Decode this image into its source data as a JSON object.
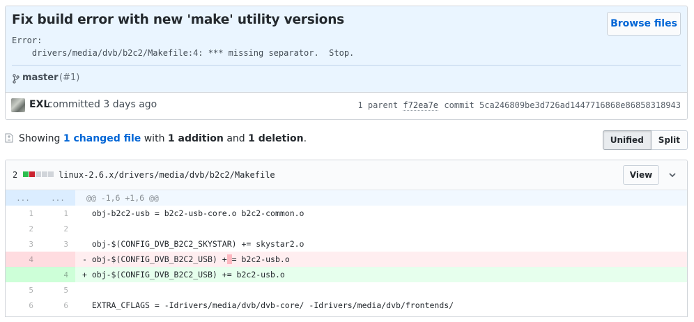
{
  "commit": {
    "title": "Fix build error with new 'make' utility versions",
    "description": "Error:\n    drivers/media/dvb/b2c2/Makefile:4: *** missing separator.  Stop.",
    "browse_label": "Browse files",
    "branch": "master",
    "pr": "(#1)",
    "author": "EXL",
    "committed_text": "committed 3 days ago",
    "parent_label": "1 parent",
    "parent_sha": "f72ea7e",
    "commit_label": "commit",
    "commit_sha": "5ca246809be3d726ad1447716868e86858318943"
  },
  "summary": {
    "showing": "Showing",
    "changed": "1 changed file",
    "with": "with",
    "additions": "1 addition",
    "and": "and",
    "deletions": "1 deletion",
    "period": ".",
    "unified_label": "Unified",
    "split_label": "Split"
  },
  "file": {
    "change_count": "2",
    "path": "linux-2.6.x/drivers/media/dvb/b2c2/Makefile",
    "view_label": "View",
    "diffstat_colors": [
      "#2cbe4e",
      "#cb2431",
      "#d1d5da",
      "#d1d5da",
      "#d1d5da"
    ]
  },
  "diff": {
    "hunk_left": "...",
    "hunk_right": "...",
    "hunk_header": "@@ -1,6 +1,6 @@",
    "lines": [
      {
        "old": "1",
        "new": "1",
        "text": "  obj-b2c2-usb = b2c2-usb-core.o b2c2-common.o"
      },
      {
        "old": "2",
        "new": "2",
        "text": " "
      },
      {
        "old": "3",
        "new": "3",
        "text": "  obj-$(CONFIG_DVB_B2C2_SKYSTAR) += skystar2.o"
      },
      {
        "old": "4",
        "new": "",
        "text_pre": "- obj-$(CONFIG_DVB_B2C2_USB) +",
        "text_hl": " ",
        "text_post": "= b2c2-usb.o"
      },
      {
        "old": "",
        "new": "4",
        "text": "+ obj-$(CONFIG_DVB_B2C2_USB) += b2c2-usb.o"
      },
      {
        "old": "5",
        "new": "5",
        "text": " "
      },
      {
        "old": "6",
        "new": "6",
        "text": "  EXTRA_CFLAGS = -Idrivers/media/dvb/dvb-core/ -Idrivers/media/dvb/frontends/"
      }
    ]
  }
}
